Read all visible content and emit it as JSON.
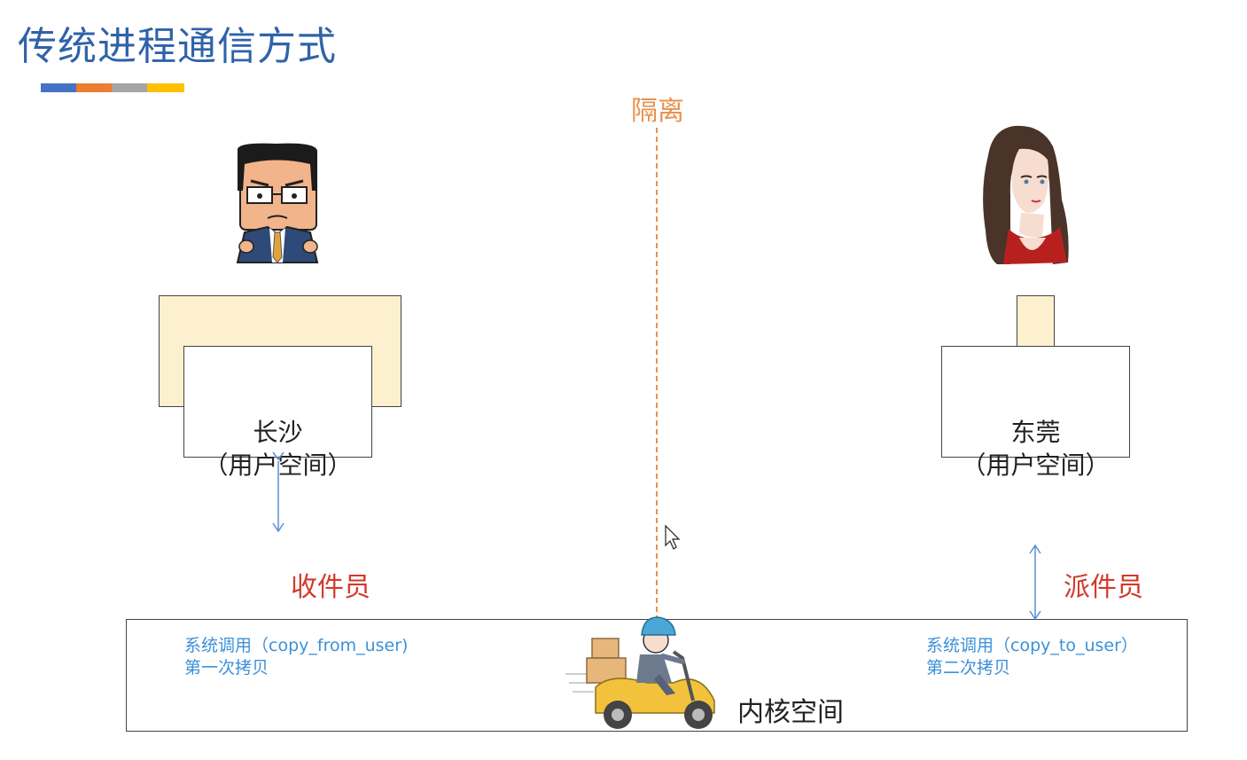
{
  "slide": {
    "title": "传统进程通信方式",
    "accent_colors": [
      "#4472c4",
      "#ed7d31",
      "#a5a5a5",
      "#ffc000"
    ]
  },
  "isolation": {
    "label": "隔离",
    "color": "#e8914f"
  },
  "left": {
    "city": "长沙",
    "space": "（用户空间）",
    "role": "收件员",
    "syscall": "系统调用（copy_from_user)",
    "copy": "第一次拷贝",
    "character_icon": "man-with-glasses-icon"
  },
  "right": {
    "city": "东莞",
    "space": "（用户空间）",
    "role": "派件员",
    "syscall": "系统调用（copy_to_user）",
    "copy": "第二次拷贝",
    "character_icon": "woman-icon"
  },
  "kernel": {
    "label": "内核空间",
    "courier_icon": "courier-scooter-icon"
  },
  "colors": {
    "title": "#2f63a9",
    "role": "#d33a2a",
    "syscall": "#3d90d8",
    "box_fill": "#fcf0cf",
    "arrow": "#5b8fd6"
  }
}
